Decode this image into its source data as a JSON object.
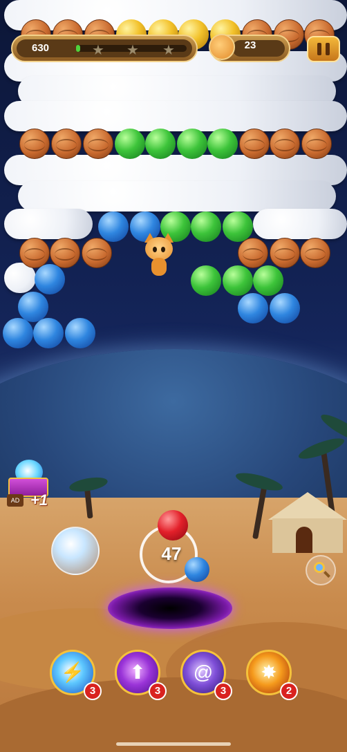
{
  "hud": {
    "score": "630",
    "progress_fraction": 0.04,
    "stars_earned": 0,
    "stars_total": 3,
    "moves_left": "23",
    "pause_icon": "pause-icon"
  },
  "shooter": {
    "shots_remaining": "47",
    "current_bubble_color": "red",
    "next_bubble_color": "blue"
  },
  "chest_reward": {
    "label": "+1",
    "tag": "AD"
  },
  "boosters": [
    {
      "name": "lightning-orb",
      "count": "3"
    },
    {
      "name": "arrow-orb",
      "count": "3"
    },
    {
      "name": "vortex-orb",
      "count": "3"
    },
    {
      "name": "fire-orb",
      "count": "2"
    }
  ],
  "colors": {
    "wood": "#c8692e",
    "green": "#3dc43a",
    "blue": "#2f86e0",
    "gold": "#f2c12a",
    "red": "#e3202a"
  }
}
